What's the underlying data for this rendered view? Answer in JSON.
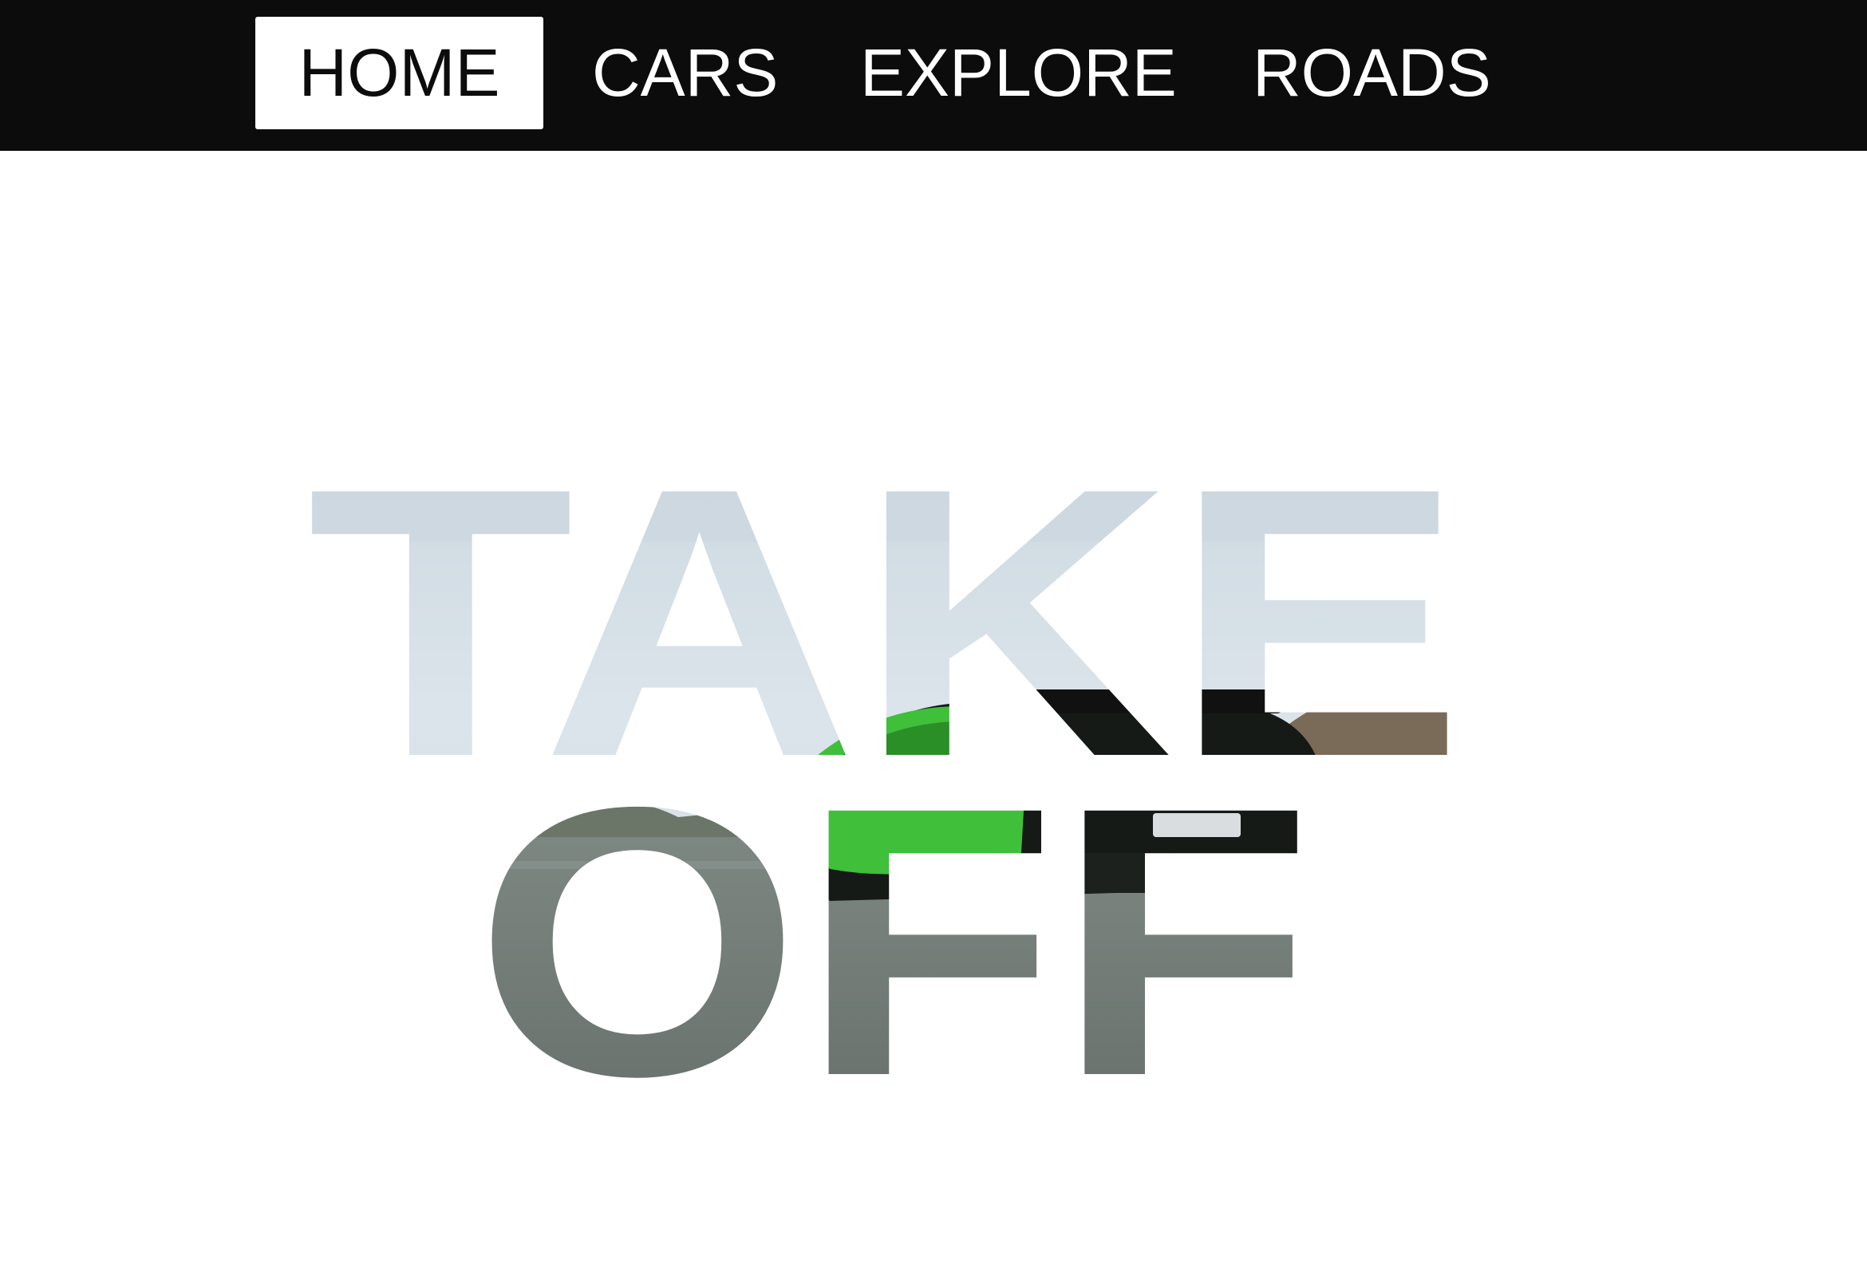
{
  "nav": {
    "items": [
      {
        "label": "HOME",
        "active": true
      },
      {
        "label": "CARS",
        "active": false
      },
      {
        "label": "EXPLORE",
        "active": false
      },
      {
        "label": "ROADS",
        "active": false
      }
    ]
  },
  "hero": {
    "line1": "TAKE",
    "line2": "OFF"
  },
  "colors": {
    "nav_background": "#0c0c0c",
    "nav_text": "#ffffff",
    "active_background": "#ffffff",
    "active_text": "#0c0c0c",
    "page_background": "#ffffff",
    "sky": "#d5e0e8",
    "road": "#6e7672",
    "car_green": "#3fbf3a"
  }
}
